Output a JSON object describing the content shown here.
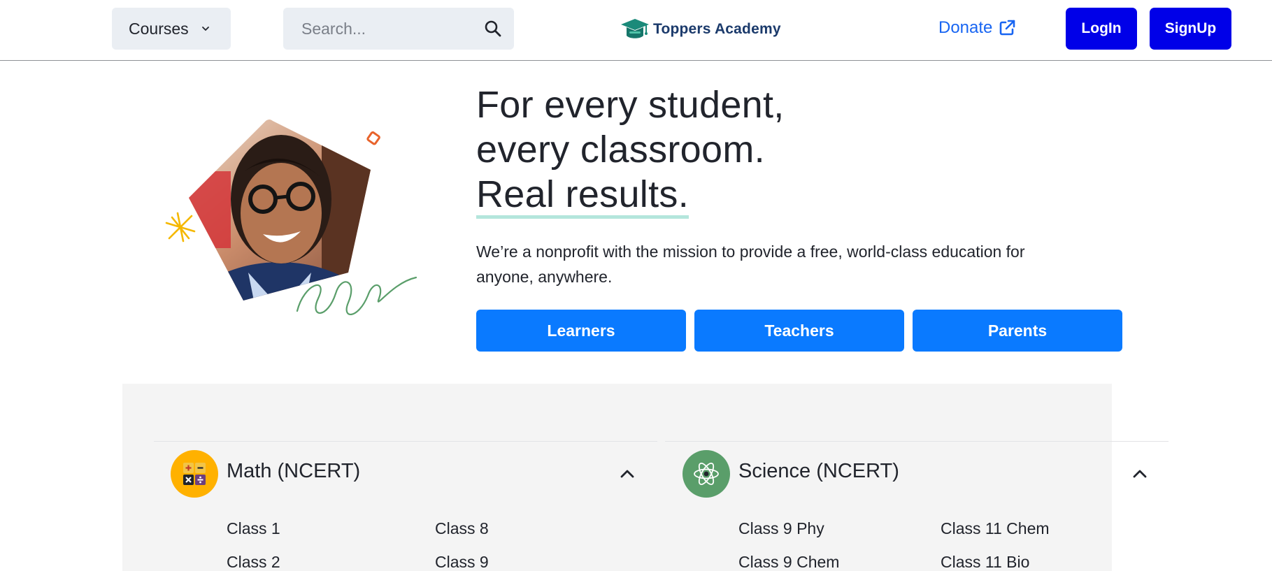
{
  "header": {
    "courses_label": "Courses",
    "search_placeholder": "Search...",
    "logo_text": "Toppers Academy",
    "donate_label": "Donate",
    "login_label": "LogIn",
    "signup_label": "SignUp"
  },
  "hero": {
    "headline_line1": "For every student,",
    "headline_line2": "every classroom.",
    "headline_line3": "Real results.",
    "mission": "We’re a nonprofit with the mission to provide a free, world-class education for anyone, anywhere.",
    "buttons": [
      "Learners",
      "Teachers",
      "Parents"
    ]
  },
  "subjects": [
    {
      "title": "Math (NCERT)",
      "icon": "calculator-icon",
      "classes_col1": [
        "Class 1",
        "Class 2"
      ],
      "classes_col2": [
        "Class 8",
        "Class 9"
      ]
    },
    {
      "title": "Science (NCERT)",
      "icon": "atom-icon",
      "classes_col1": [
        "Class 9 Phy",
        "Class 9 Chem"
      ],
      "classes_col2": [
        "Class 11 Chem",
        "Class 11 Bio"
      ]
    }
  ],
  "colors": {
    "primary_button": "#0000e8",
    "audience_button": "#0a7aff",
    "link": "#1865f2",
    "math_accent": "#ffb100",
    "science_accent": "#5a9e6a",
    "headline_underline": "#b4e6dc"
  }
}
